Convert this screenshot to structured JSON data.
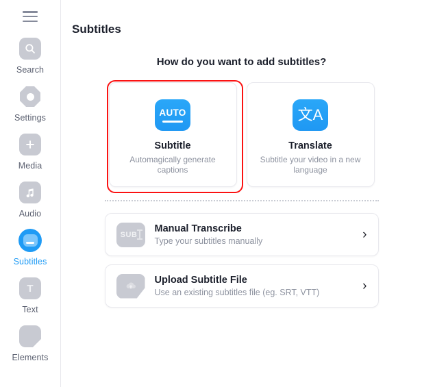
{
  "sidebar": {
    "menu_icon": "hamburger-icon",
    "items": [
      {
        "label": "Search",
        "icon": "search-icon",
        "active": false
      },
      {
        "label": "Settings",
        "icon": "settings-icon",
        "active": false
      },
      {
        "label": "Media",
        "icon": "media-plus-icon",
        "active": false
      },
      {
        "label": "Audio",
        "icon": "audio-note-icon",
        "active": false
      },
      {
        "label": "Subtitles",
        "icon": "subtitles-icon",
        "active": true
      },
      {
        "label": "Text",
        "icon": "text-icon",
        "active": false
      },
      {
        "label": "Elements",
        "icon": "elements-icon",
        "active": false
      }
    ]
  },
  "main": {
    "page_title": "Subtitles",
    "question": "How do you want to add subtitles?",
    "cards": [
      {
        "title": "Subtitle",
        "subtitle": "Automagically generate captions",
        "icon": "auto-badge-icon",
        "icon_text": "AUTO",
        "highlighted": true
      },
      {
        "title": "Translate",
        "subtitle": "Subtitle your video in a new language",
        "icon": "translate-icon",
        "icon_text": "文A",
        "highlighted": false
      }
    ],
    "rows": [
      {
        "title": "Manual Transcribe",
        "subtitle": "Type your subtitles manually",
        "icon": "sub-text-cursor-icon",
        "icon_text": "SUB",
        "chevron": "›"
      },
      {
        "title": "Upload Subtitle File",
        "subtitle": "Use an existing subtitles file (eg. SRT, VTT)",
        "icon": "cloud-upload-icon",
        "icon_text": "",
        "chevron": "›"
      }
    ]
  },
  "colors": {
    "accent_blue": "#1f9bf5",
    "highlight_red": "#fb1212",
    "icon_grey": "#c8cad2",
    "text_dark": "#1b1f2b",
    "text_muted": "#8d929f"
  }
}
